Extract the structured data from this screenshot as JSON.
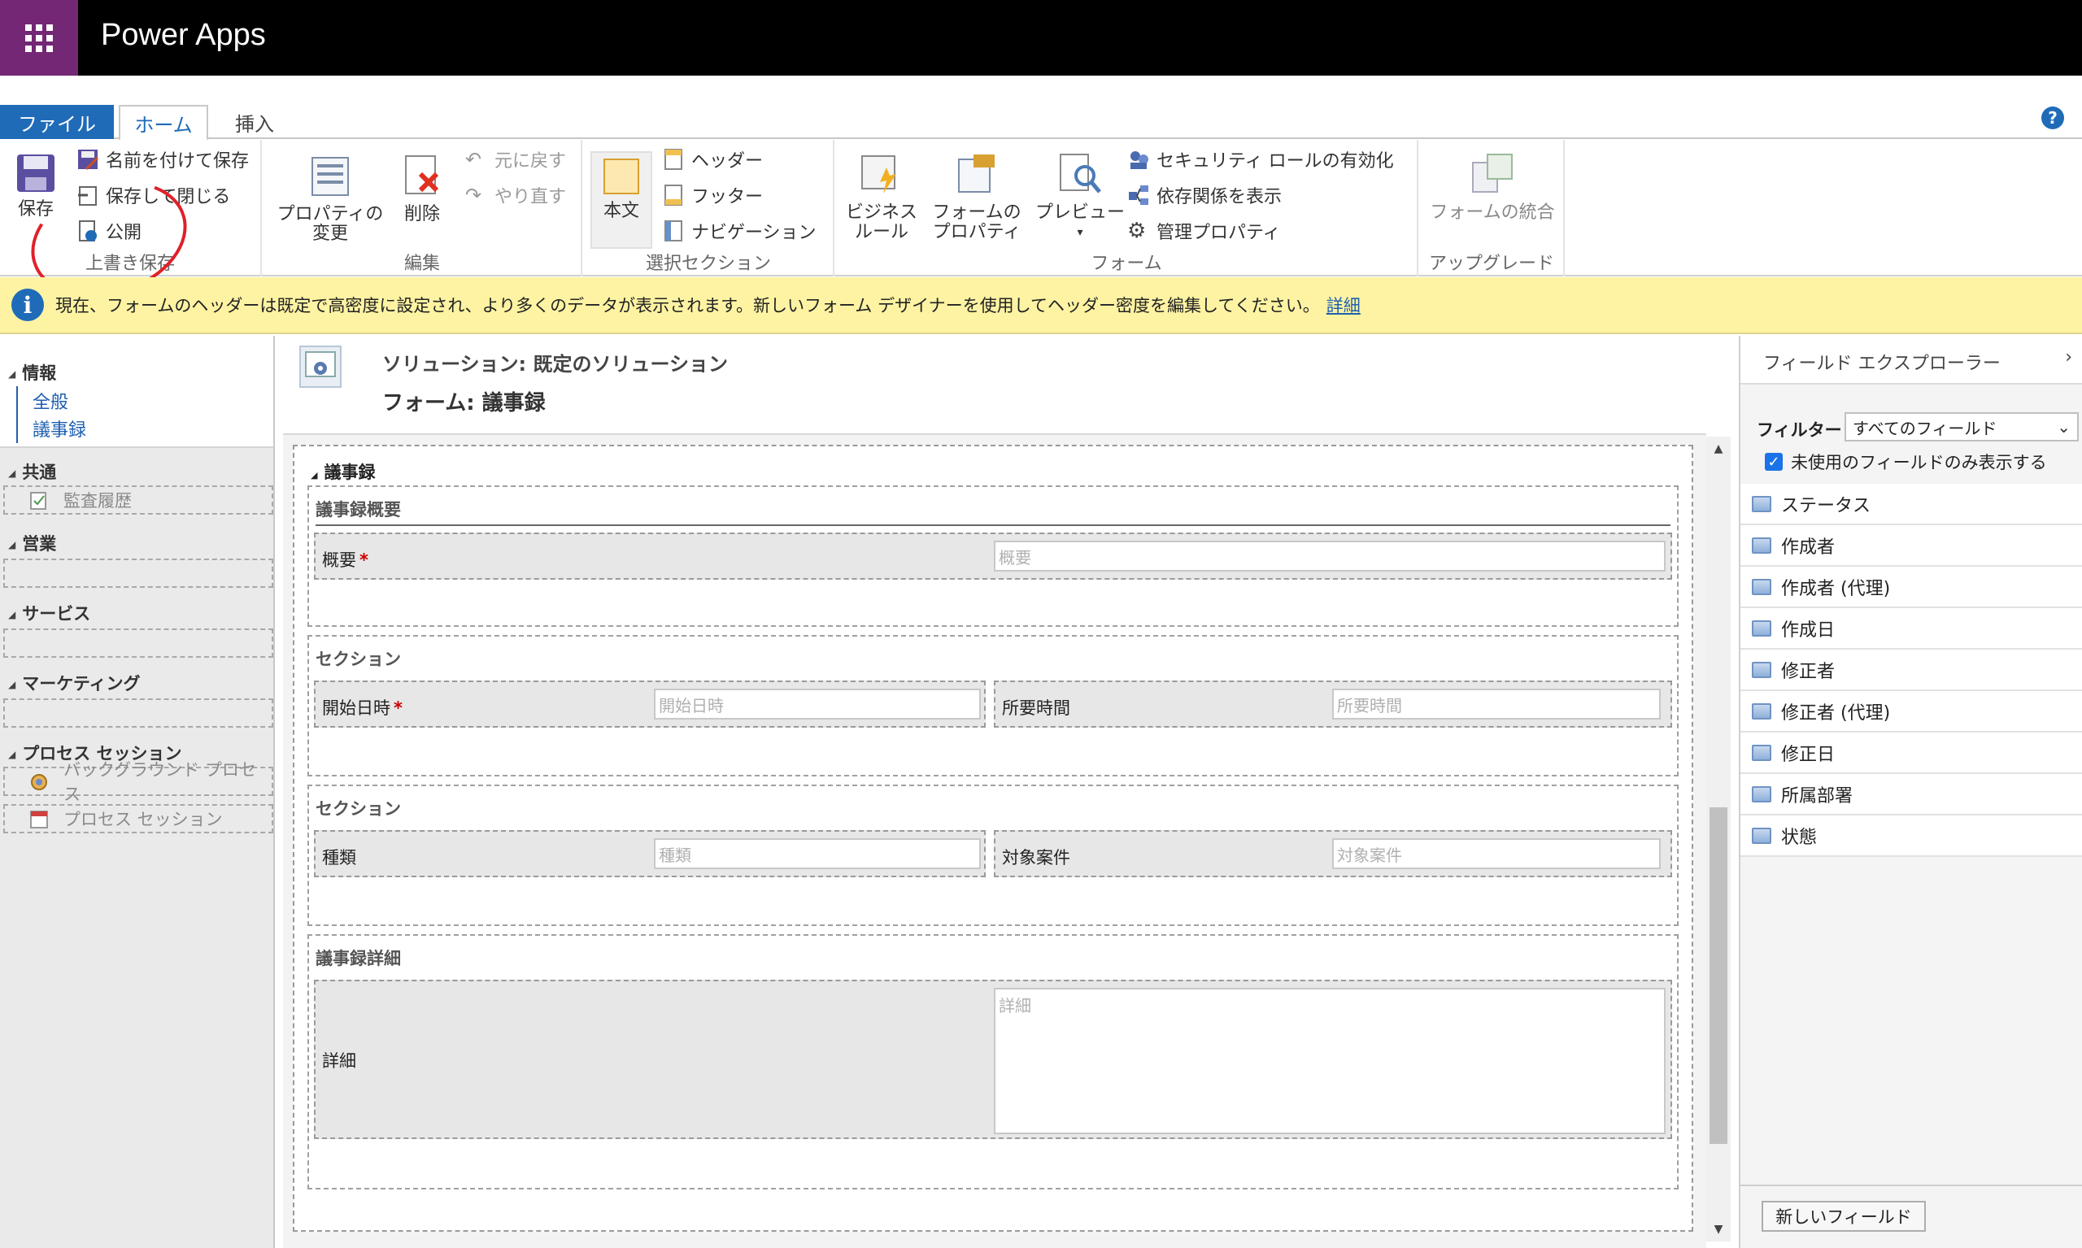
{
  "app": {
    "title": "Power Apps"
  },
  "tabs": {
    "file": "ファイル",
    "home": "ホーム",
    "insert": "挿入"
  },
  "help": "?",
  "ribbon": {
    "save": {
      "save": "保存",
      "save_as": "名前を付けて保存",
      "save_close": "保存して閉じる",
      "publish": "公開",
      "group": "上書き保存"
    },
    "edit": {
      "properties": "プロパティの\n変更",
      "delete": "削除",
      "undo": "元に戻す",
      "redo": "やり直す",
      "group": "編集"
    },
    "select": {
      "body": "本文",
      "header": "ヘッダー",
      "footer": "フッター",
      "navigation": "ナビゲーション",
      "group": "選択セクション"
    },
    "form": {
      "business_rules": "ビジネス\nルール",
      "form_properties": "フォームの\nプロパティ",
      "preview": "プレビュー",
      "security_roles": "セキュリティ ロールの有効化",
      "show_dependencies": "依存関係を表示",
      "managed_properties": "管理プロパティ",
      "group": "フォーム"
    },
    "upgrade": {
      "merge_forms": "フォームの統合",
      "group": "アップグレード"
    }
  },
  "infobar": {
    "text": "現在、フォームのヘッダーは既定で高密度に設定され、より多くのデータが表示されます。新しいフォーム デザイナーを使用してヘッダー密度を編集してください。",
    "link": "詳細"
  },
  "nav": {
    "info": "情報",
    "general": "全般",
    "minutes": "議事録",
    "common": "共通",
    "audit": "監査履歴",
    "sales": "営業",
    "service": "サービス",
    "marketing": "マーケティング",
    "process_session": "プロセス セッション",
    "background_process": "バックグラウンド プロセス",
    "process_session_item": "プロセス セッション"
  },
  "main": {
    "solution": "ソリューション: 既定のソリューション",
    "form": "フォーム: 議事録",
    "tab_title": "議事録",
    "sections": {
      "summary": {
        "title": "議事録概要",
        "label": "概要",
        "placeholder": "概要",
        "required": "*"
      },
      "section1": {
        "title": "セクション",
        "start_label": "開始日時",
        "start_placeholder": "開始日時",
        "duration_label": "所要時間",
        "duration_placeholder": "所要時間",
        "required": "*"
      },
      "section2": {
        "title": "セクション",
        "type_label": "種類",
        "type_placeholder": "種類",
        "project_label": "対象案件",
        "project_placeholder": "対象案件"
      },
      "detail": {
        "title": "議事録詳細",
        "label": "詳細",
        "placeholder": "詳細"
      }
    }
  },
  "explorer": {
    "title": "フィールド エクスプローラー",
    "chevron": "›",
    "filter_label": "フィルター",
    "filter_value": "すべてのフィールド",
    "unused_only": "未使用のフィールドのみ表示する",
    "fields": [
      "ステータス",
      "作成者",
      "作成者 (代理)",
      "作成日",
      "修正者",
      "修正者 (代理)",
      "修正日",
      "所属部署",
      "状態"
    ],
    "new_field": "新しいフィールド"
  },
  "colors": {
    "accent": "#1f6bb8",
    "waffle": "#742774",
    "infobar": "#fdf3a3",
    "annotation": "#e0202a"
  }
}
